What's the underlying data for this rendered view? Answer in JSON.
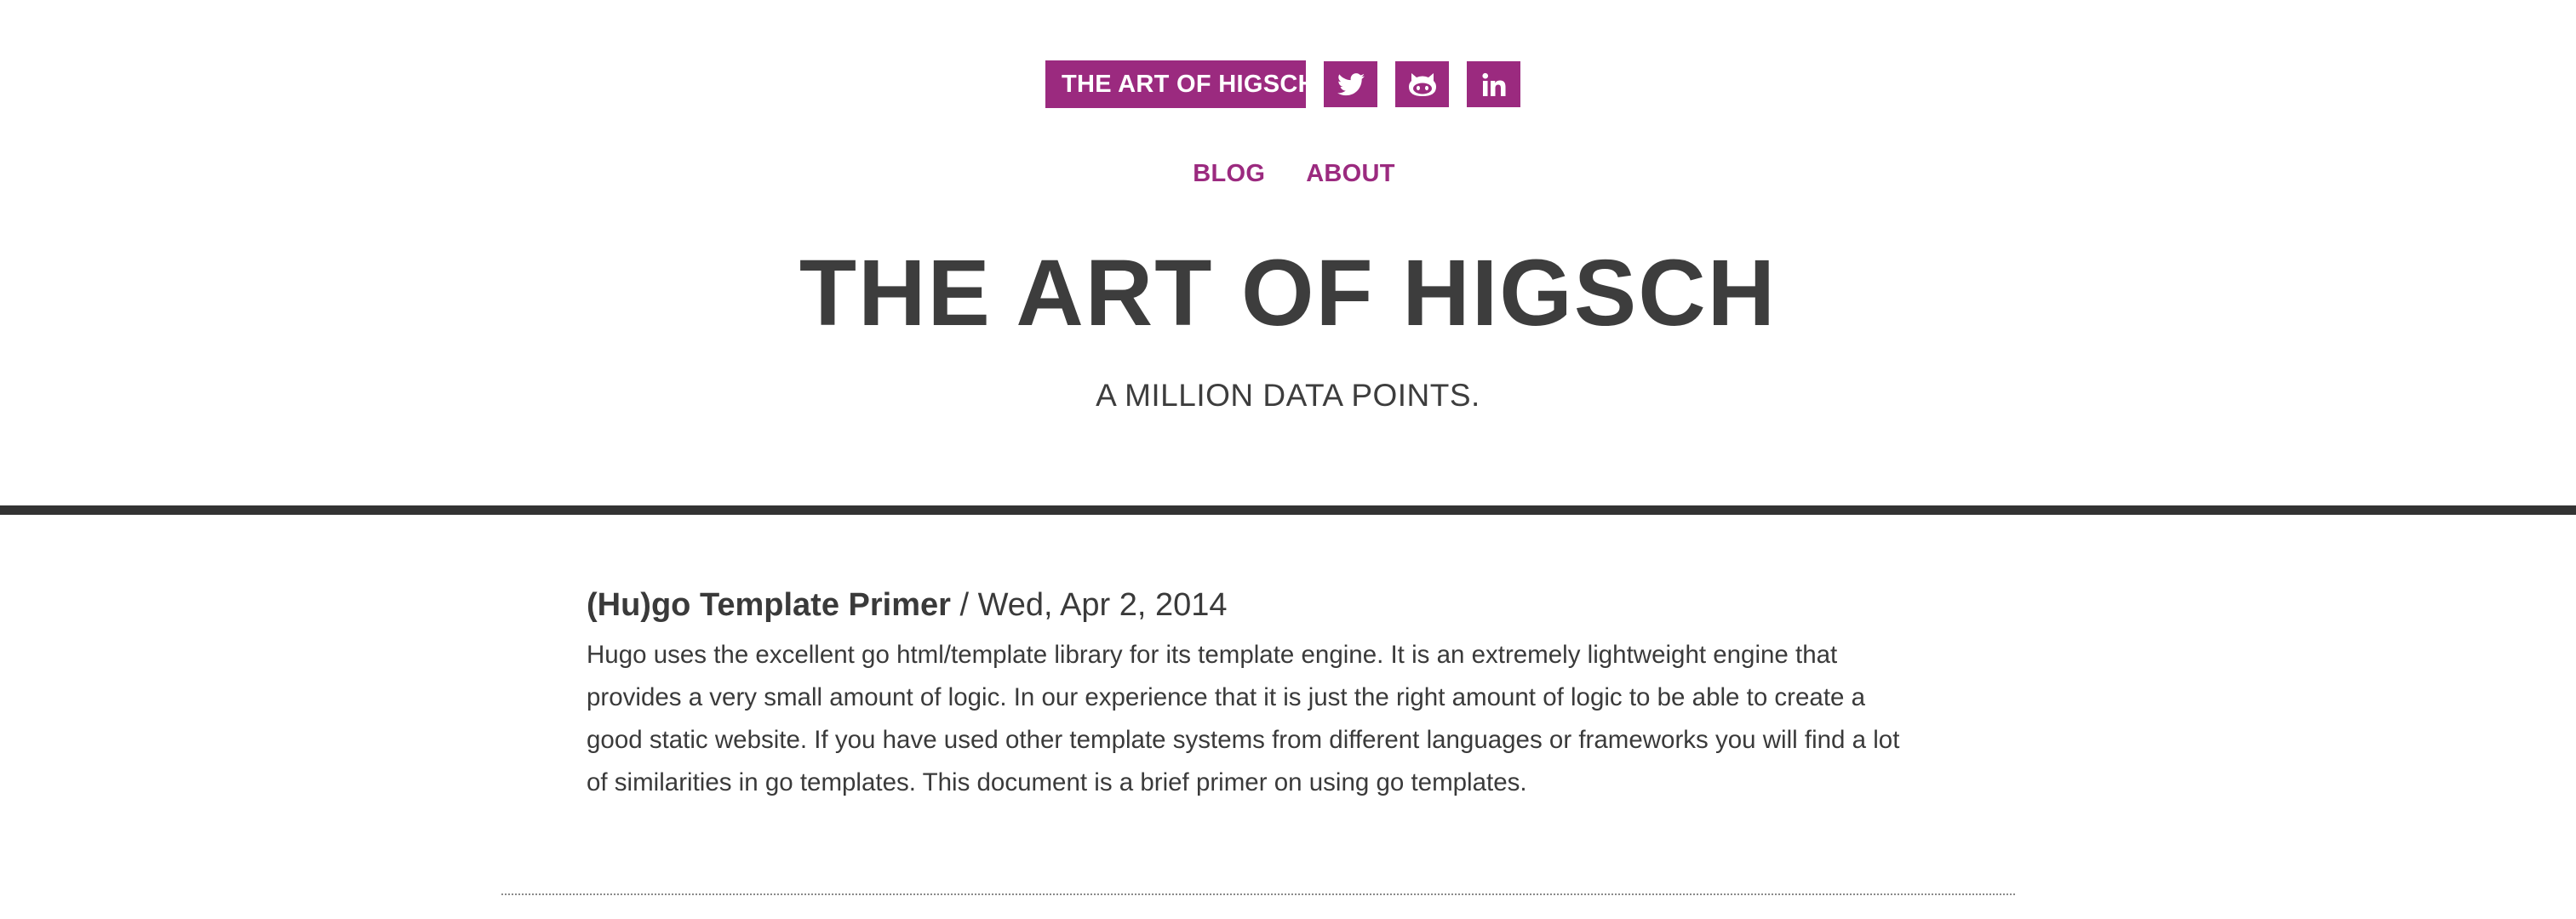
{
  "header": {
    "brand_label": "THE ART OF HIGSCH",
    "social": [
      {
        "icon": "twitter-icon",
        "label": "Twitter"
      },
      {
        "icon": "github-icon",
        "label": "GitHub"
      },
      {
        "icon": "linkedin-icon",
        "label": "LinkedIn"
      }
    ],
    "accent_color": "#9b2a7f"
  },
  "nav": {
    "items": [
      "BLOG",
      "ABOUT"
    ]
  },
  "hero": {
    "title": "THE ART OF HIGSCH",
    "subtitle": "A MILLION DATA POINTS."
  },
  "posts": [
    {
      "title": "(Hu)go Template Primer",
      "separator": "/",
      "date": "Wed, Apr 2, 2014",
      "summary": "Hugo uses the excellent go html/template library for its template engine. It is an extremely lightweight engine that provides a very small amount of logic. In our experience that it is just the right amount of logic to be able to create a good static website. If you have used other template systems from different languages or frameworks you will find a lot of similarities in go templates. This document is a brief primer on using go templates."
    }
  ]
}
